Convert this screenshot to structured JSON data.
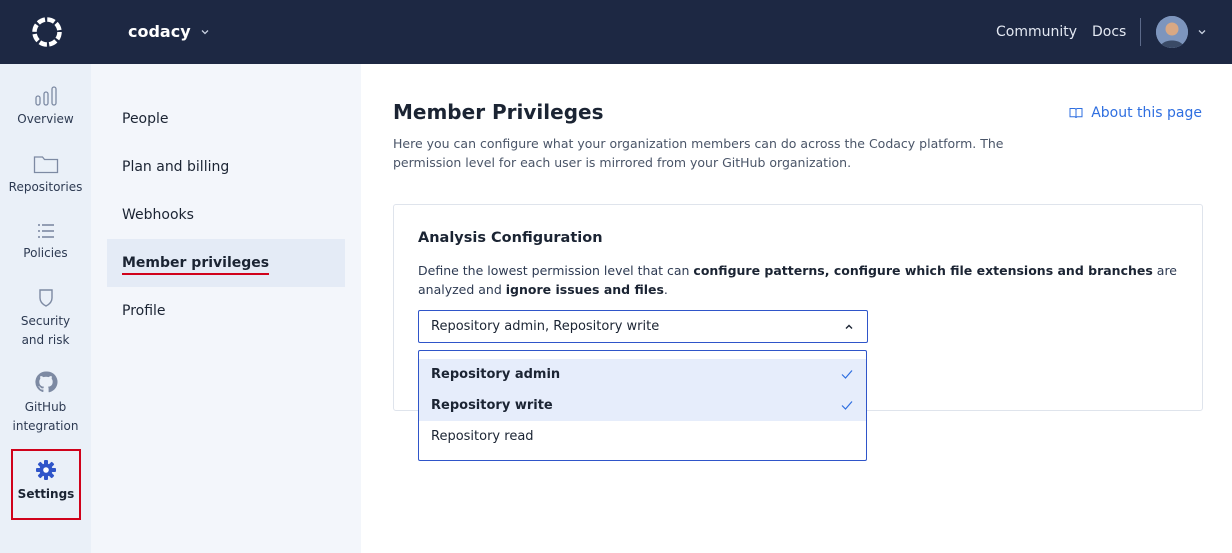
{
  "app": {
    "org_name": "codacy"
  },
  "topnav": {
    "community": "Community",
    "docs": "Docs"
  },
  "rail": {
    "overview": "Overview",
    "repositories": "Repositories",
    "policies": "Policies",
    "security_line1": "Security",
    "security_line2": "and risk",
    "github_line1": "GitHub",
    "github_line2": "integration",
    "settings": "Settings"
  },
  "subnav": {
    "items": [
      "People",
      "Plan and billing",
      "Webhooks",
      "Member privileges",
      "Profile"
    ],
    "active": "Member privileges"
  },
  "main": {
    "title": "Member Privileges",
    "about_link": "About this page",
    "intro": "Here you can configure what your organization members can do across the Codacy platform. The permission level for each user is mirrored from your GitHub organization."
  },
  "card": {
    "title": "Analysis Configuration",
    "desc_part1": "Define the lowest permission level that can ",
    "desc_bold1": "configure patterns, configure which file extensions and branches",
    "desc_part2": " are analyzed and ",
    "desc_bold2": "ignore issues and files",
    "desc_part3": ".",
    "select_value": "Repository admin, Repository write"
  },
  "dropdown": {
    "options": [
      {
        "label": "Repository admin",
        "selected": true
      },
      {
        "label": "Repository write",
        "selected": true
      },
      {
        "label": "Repository read",
        "selected": false
      }
    ]
  },
  "colors": {
    "topbar": "#1d2843",
    "accent": "#2f55c9",
    "link": "#2f6fe0",
    "highlight": "#d0021b"
  }
}
